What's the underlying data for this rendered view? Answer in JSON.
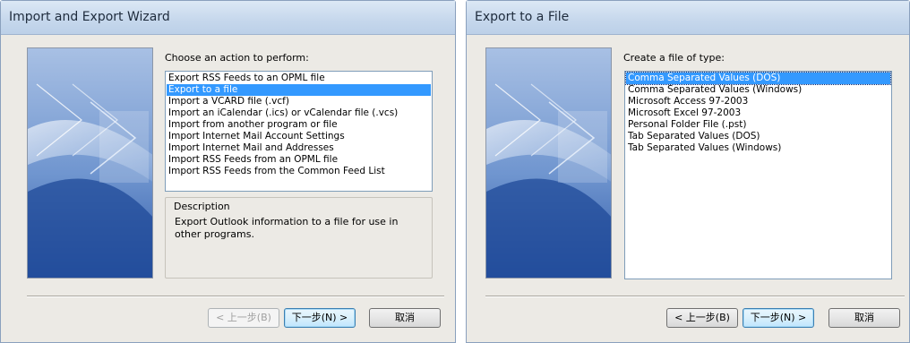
{
  "wizard": {
    "title": "Import and Export Wizard",
    "prompt": "Choose an action to perform:",
    "actions": [
      "Export RSS Feeds to an OPML file",
      "Export to a file",
      "Import a VCARD file (.vcf)",
      "Import an iCalendar (.ics) or vCalendar file (.vcs)",
      "Import from another program or file",
      "Import Internet Mail Account Settings",
      "Import Internet Mail and Addresses",
      "Import RSS Feeds from an OPML file",
      "Import RSS Feeds from the Common Feed List"
    ],
    "selected_action": "Export to a file",
    "description_label": "Description",
    "description_text": "Export Outlook information to a file for use in other programs.",
    "buttons": {
      "back": "< 上一步(B)",
      "next": "下一步(N) >",
      "cancel": "取消"
    }
  },
  "export_dialog": {
    "title": "Export to a File",
    "prompt": "Create a file of type:",
    "file_types": [
      "Comma Separated Values (DOS)",
      "Comma Separated Values (Windows)",
      "Microsoft Access 97-2003",
      "Microsoft Excel 97-2003",
      "Personal Folder File (.pst)",
      "Tab Separated Values (DOS)",
      "Tab Separated Values (Windows)"
    ],
    "selected_file_type": "Comma Separated Values (DOS)",
    "buttons": {
      "back": "< 上一步(B)",
      "next": "下一步(N) >",
      "cancel": "取消"
    }
  },
  "colors": {
    "selection": "#3399ff",
    "titlebar": "#c5d7ec",
    "dialog_bg": "#eceae5",
    "default_button_border": "#3c7fb1"
  }
}
